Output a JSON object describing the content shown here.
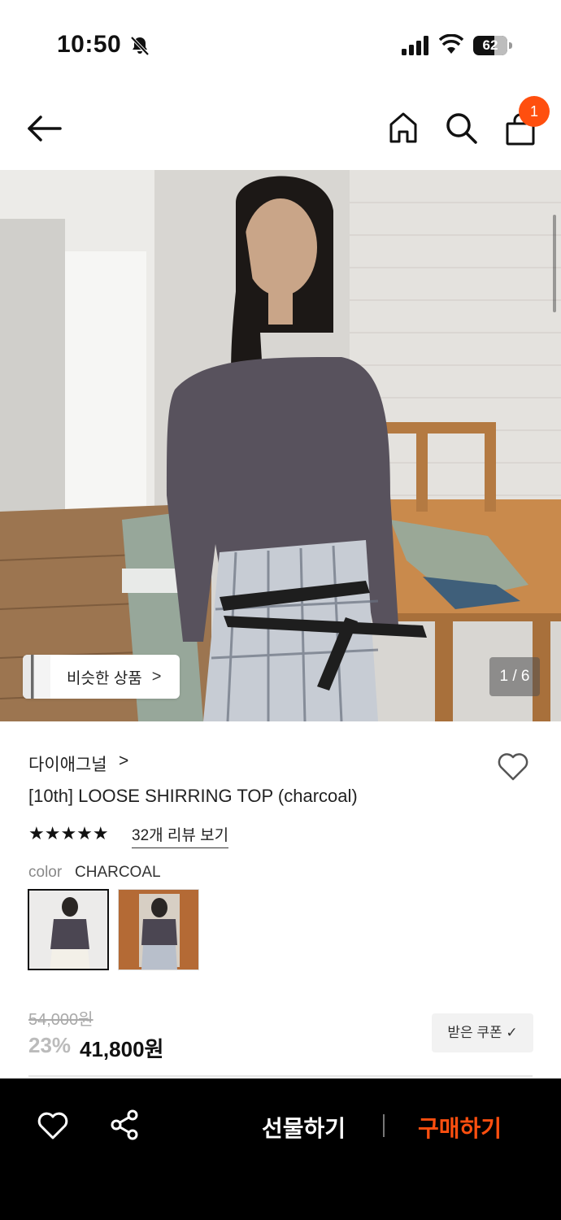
{
  "status_bar": {
    "time": "10:50",
    "battery": "62",
    "battery_level_percent": 62,
    "icons": [
      "bell-slash-icon",
      "cellular-signal-icon",
      "wifi-icon",
      "battery-icon"
    ]
  },
  "header": {
    "cart_badge": "1",
    "icons": [
      "back-arrow-icon",
      "home-icon",
      "search-icon",
      "shopping-bag-icon"
    ]
  },
  "gallery": {
    "similar_label": "비슷한 상품",
    "similar_chevron": ">",
    "pager": "1 / 6"
  },
  "product": {
    "brand": "다이애그널",
    "brand_chevron": ">",
    "title": "[10th] LOOSE SHIRRING TOP (charcoal)",
    "stars": "★★★★★",
    "rating": 5,
    "reviews_link": "32개 리뷰 보기",
    "color_label": "color",
    "color_value": "CHARCOAL",
    "original_price": "54,000원",
    "discount": "23%",
    "price": "41,800원",
    "coupon_label": "받은 쿠폰 ✓"
  },
  "bottom_bar": {
    "gift_label": "선물하기",
    "buy_label": "구매하기",
    "icons": [
      "heart-outline-icon",
      "share-icon"
    ]
  },
  "colors": {
    "accent": "#ff4f0f",
    "bottom_bar_bg": "#000000",
    "discount_gray": "#bbbbbb"
  }
}
